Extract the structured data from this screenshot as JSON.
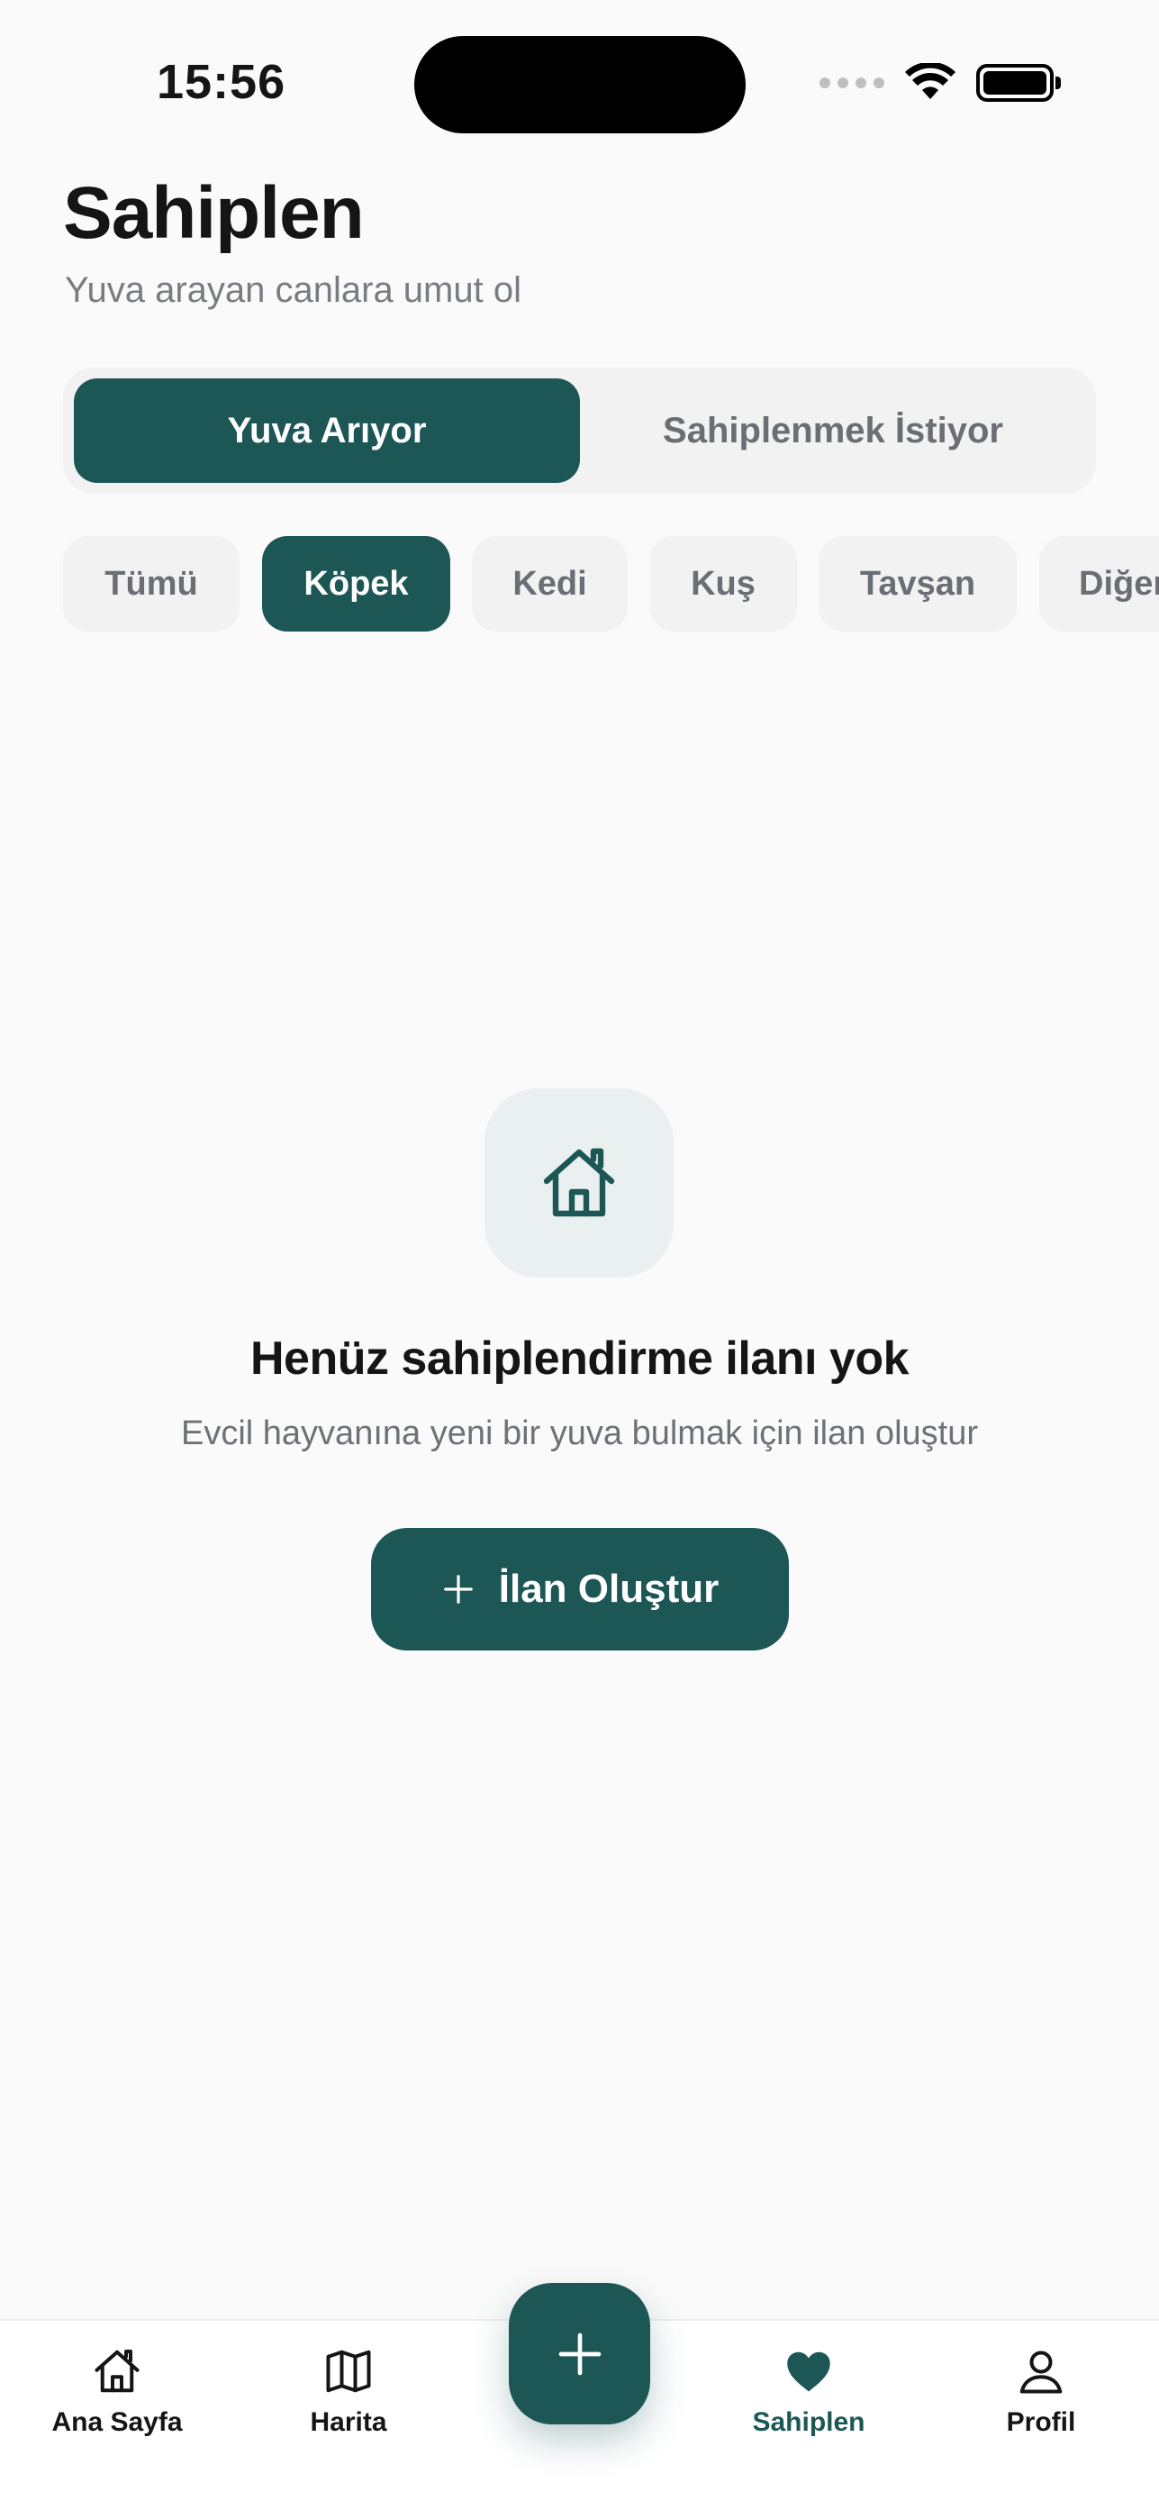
{
  "status_bar": {
    "time": "15:56"
  },
  "header": {
    "title": "Sahiplen",
    "subtitle": "Yuva arayan canlara umut ol"
  },
  "segment": {
    "active_label": "Yuva Arıyor",
    "inactive_label": "Sahiplenmek İstiyor"
  },
  "chips": [
    {
      "label": "Tümü",
      "selected": false
    },
    {
      "label": "Köpek",
      "selected": true
    },
    {
      "label": "Kedi",
      "selected": false
    },
    {
      "label": "Kuş",
      "selected": false
    },
    {
      "label": "Tavşan",
      "selected": false
    },
    {
      "label": "Diğer",
      "selected": false
    }
  ],
  "empty_state": {
    "icon": "home-icon",
    "title": "Henüz sahiplendirme ilanı yok",
    "description": "Evcil hayvanına yeni bir yuva bulmak için ilan oluştur",
    "button_label": "İlan Oluştur"
  },
  "bottom_nav": {
    "items": [
      {
        "label": "Ana Sayfa",
        "icon": "home-icon"
      },
      {
        "label": "Harita",
        "icon": "map-icon"
      },
      {
        "label": "Sahiplen",
        "icon": "heart-icon",
        "active": true
      },
      {
        "label": "Profil",
        "icon": "user-icon"
      }
    ],
    "fab_icon": "plus-icon"
  },
  "colors": {
    "accent": "#1c5756",
    "background": "#fafafa",
    "muted_text": "#6b6e75"
  }
}
